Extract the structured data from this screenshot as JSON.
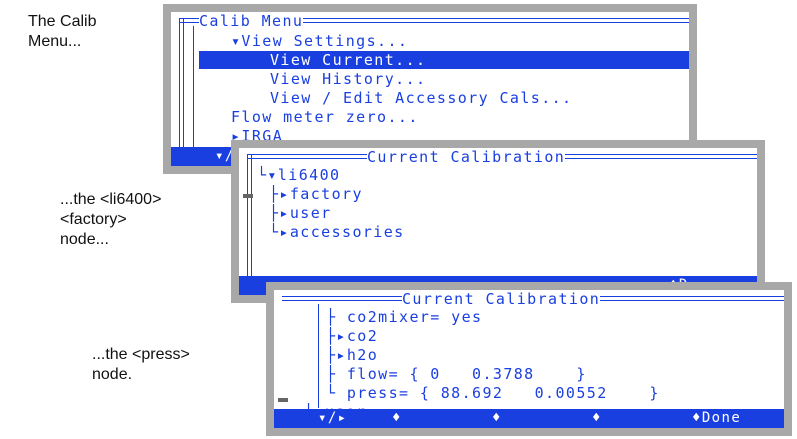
{
  "captions": {
    "calib_menu": "The Calib\nMenu...",
    "li6400_node": "...the <li6400>\n<factory>\nnode...",
    "press_node": "...the <press>\nnode."
  },
  "screen1": {
    "title": "Calib Menu",
    "items": [
      "▾View Settings...",
      "View Current...",
      "View History...",
      "View / Edit Accessory Cals...",
      "Flow meter zero...",
      "▸IRGA"
    ],
    "fkey_1": "▾/▸"
  },
  "screen2": {
    "title": "Current Calibration",
    "tree": [
      "└▾li6400",
      "├▸factory",
      "├▸user",
      "└▸accessories"
    ],
    "fkeys": [
      "",
      "",
      "",
      "",
      "♦D"
    ]
  },
  "screen3": {
    "title": "Current Calibration",
    "tree": [
      "├ co2mixer= yes",
      "├▸co2",
      "├▸h2o",
      "├ flow= { 0   0.3788    }",
      "└ press= { 88.692   0.00552    }",
      "├▸user"
    ],
    "fkeys": [
      "▾/▸",
      "♦",
      "♦",
      "♦",
      "♦Done"
    ]
  },
  "colors": {
    "lcd_text": "#1a3fe0",
    "bezel": "#a8a8a8"
  }
}
